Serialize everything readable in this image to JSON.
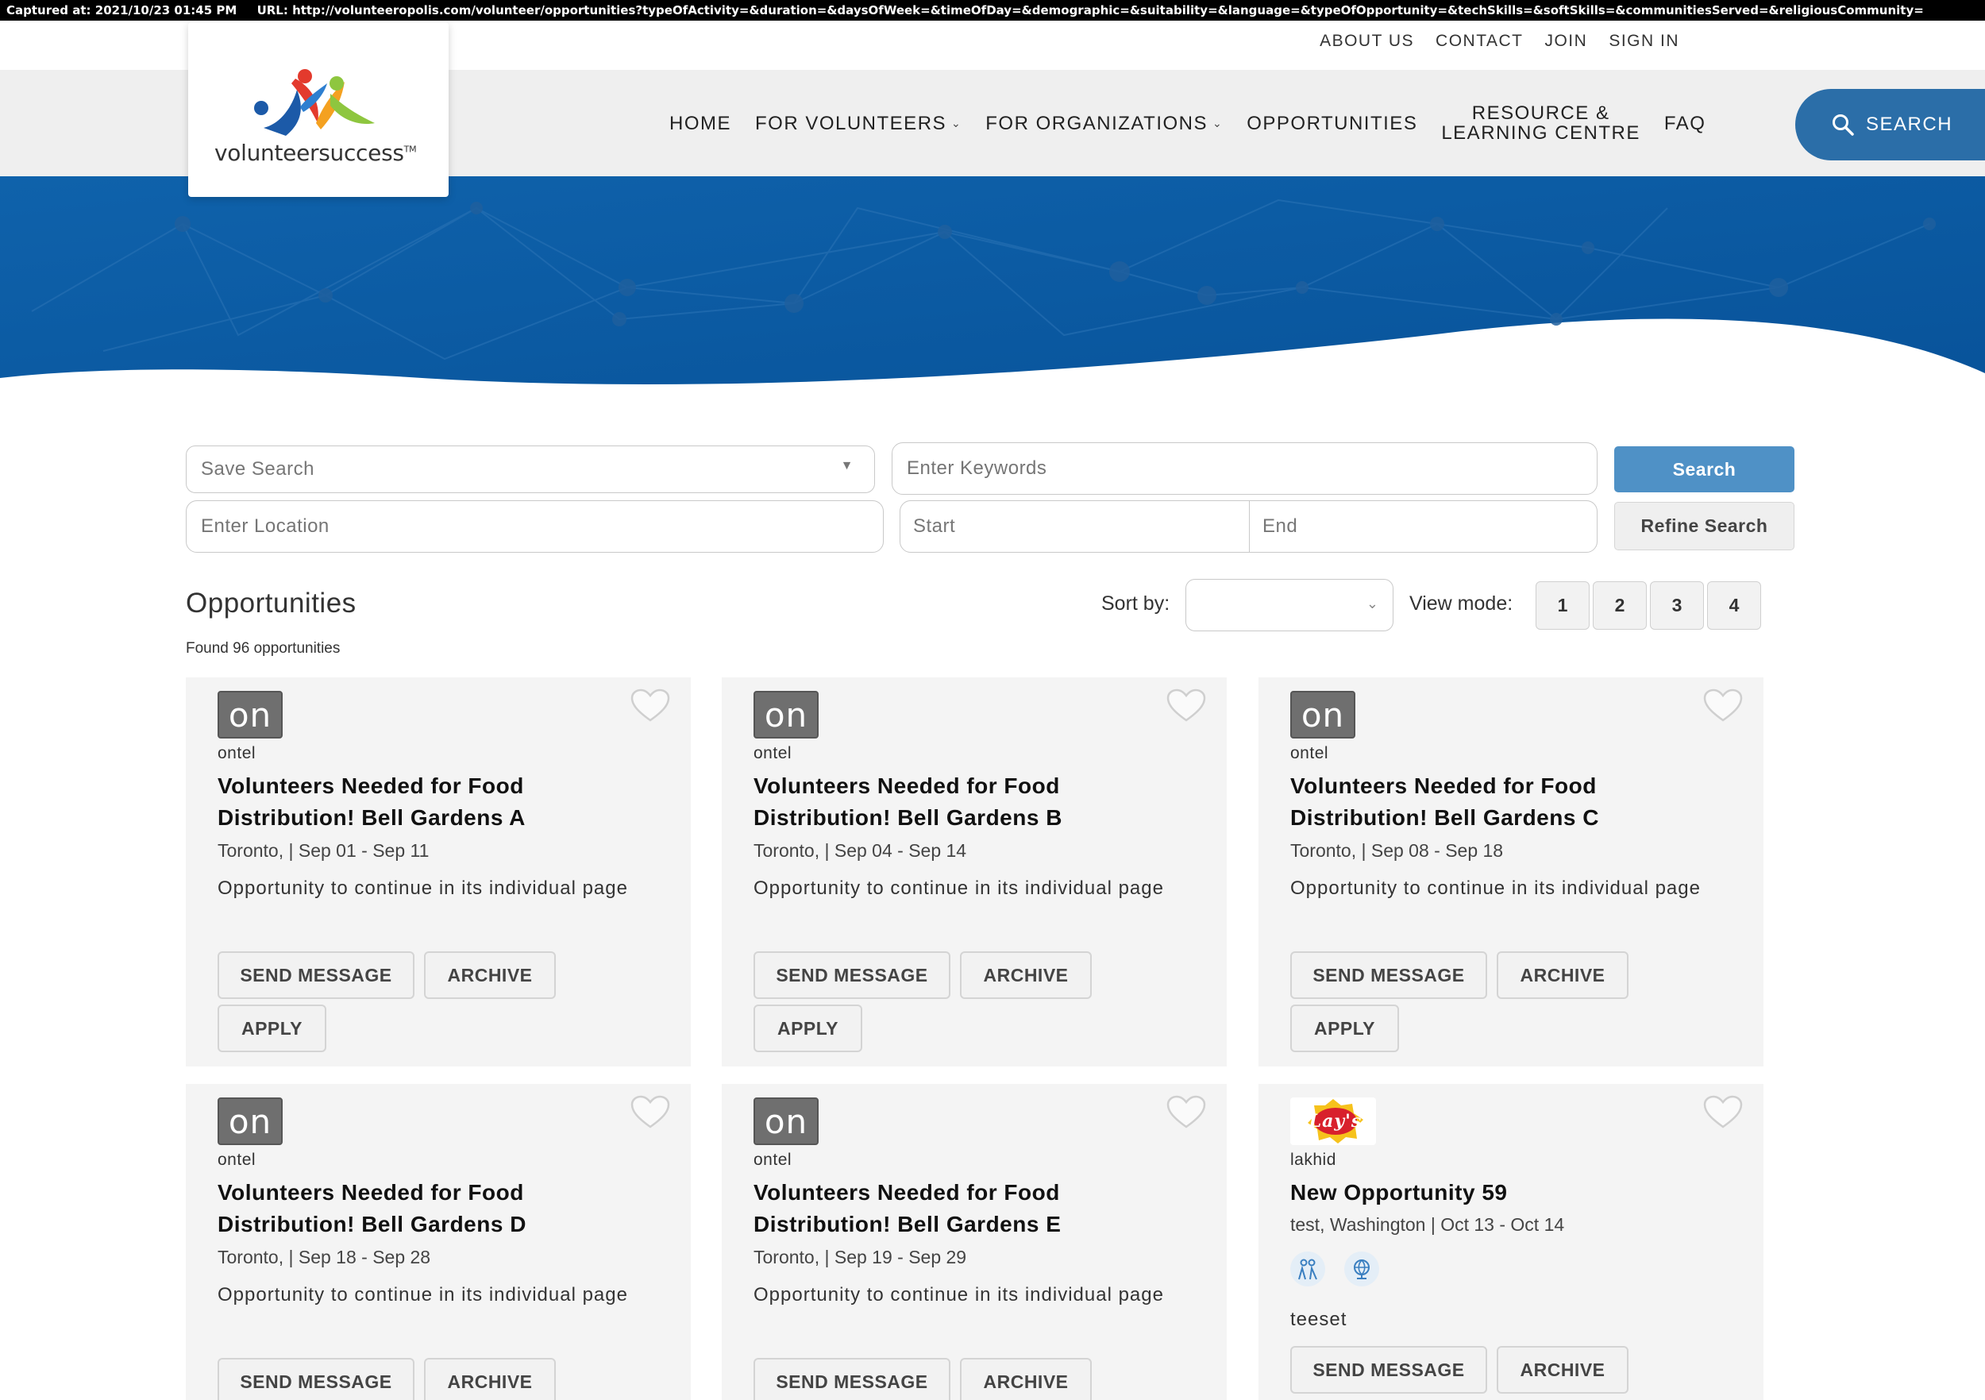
{
  "capture": {
    "captured": "Captured at: 2021/10/23 01:45 PM",
    "url": "URL: http://volunteeropolis.com/volunteer/opportunities?typeOfActivity=&duration=&daysOfWeek=&timeOfDay=&demographic=&suitability=&language=&typeOfOpportunity=&techSkills=&softSkills=&communitiesServed=&religiousCommunity="
  },
  "top_links": [
    "ABOUT US",
    "CONTACT",
    "JOIN",
    "SIGN IN"
  ],
  "logo": {
    "text": "volunteersuccess",
    "tm": "TM"
  },
  "nav": {
    "home": "HOME",
    "volunteers": "FOR VOLUNTEERS",
    "organizations": "FOR ORGANIZATIONS",
    "opportunities": "OPPORTUNITIES",
    "resource_line1": "RESOURCE &",
    "resource_line2": "LEARNING CENTRE",
    "faq": "FAQ",
    "search": "SEARCH"
  },
  "search_form": {
    "save_search_placeholder": "Save Search",
    "keywords_placeholder": "Enter Keywords",
    "search_button": "Search",
    "location_placeholder": "Enter Location",
    "start_placeholder": "Start",
    "end_placeholder": "End",
    "refine_button": "Refine Search"
  },
  "results": {
    "heading": "Opportunities",
    "found": "Found 96 opportunities",
    "sort_label": "Sort by:",
    "sort_value": "",
    "view_label": "View mode:",
    "view_modes": [
      "1",
      "2",
      "3",
      "4"
    ]
  },
  "colors": {
    "brand_blue": "#2b6ea8",
    "hero_blue": "#0b5aa0",
    "button_blue": "#4f91c6"
  },
  "cards": [
    {
      "logo": "on",
      "org": "ontel",
      "title": "Volunteers Needed for Food Distribution! Bell Gardens A",
      "meta": "Toronto, | Sep 01 - Sep 11",
      "desc": "Opportunity to continue in its individual page",
      "send": "SEND MESSAGE",
      "archive": "ARCHIVE",
      "apply": "APPLY"
    },
    {
      "logo": "on",
      "org": "ontel",
      "title": "Volunteers Needed for Food Distribution! Bell Gardens B",
      "meta": "Toronto, | Sep 04 - Sep 14",
      "desc": "Opportunity to continue in its individual page",
      "send": "SEND MESSAGE",
      "archive": "ARCHIVE",
      "apply": "APPLY"
    },
    {
      "logo": "on",
      "org": "ontel",
      "title": "Volunteers Needed for Food Distribution! Bell Gardens C",
      "meta": "Toronto, | Sep 08 - Sep 18",
      "desc": "Opportunity to continue in its individual page",
      "send": "SEND MESSAGE",
      "archive": "ARCHIVE",
      "apply": "APPLY"
    },
    {
      "logo": "on",
      "org": "ontel",
      "title": "Volunteers Needed for Food Distribution! Bell Gardens D",
      "meta": "Toronto, | Sep 18 - Sep 28",
      "desc": "Opportunity to continue in its individual page",
      "send": "SEND MESSAGE",
      "archive": "ARCHIVE"
    },
    {
      "logo": "on",
      "org": "ontel",
      "title": "Volunteers Needed for Food Distribution! Bell Gardens E",
      "meta": "Toronto, | Sep 19 - Sep 29",
      "desc": "Opportunity to continue in its individual page",
      "send": "SEND MESSAGE",
      "archive": "ARCHIVE"
    },
    {
      "logo": "Lay's",
      "org": "lakhid",
      "title": "New Opportunity 59",
      "meta": "test, Washington | Oct 13 - Oct 14",
      "desc": "teeset",
      "send": "SEND MESSAGE",
      "archive": "ARCHIVE",
      "icons": [
        "people-icon",
        "globe-icon"
      ]
    }
  ]
}
